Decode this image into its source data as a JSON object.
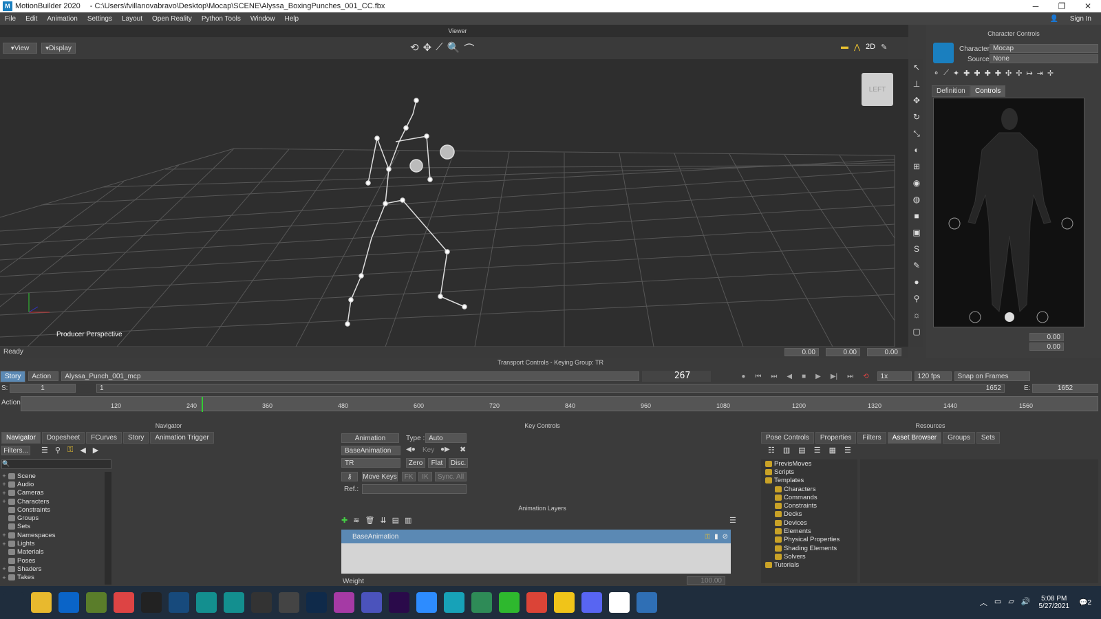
{
  "window": {
    "app_name": "MotionBuilder 2020",
    "file_path": "- C:\\Users\\fvillanovabravo\\Desktop\\Mocap\\SCENE\\Alyssa_BoxingPunches_001_CC.fbx",
    "sign_in": "Sign In"
  },
  "menu": [
    "File",
    "Edit",
    "Animation",
    "Settings",
    "Layout",
    "Open Reality",
    "Python Tools",
    "Window",
    "Help"
  ],
  "viewer": {
    "title": "Viewer",
    "view_btn": "View",
    "display_btn": "Display",
    "camera_label": "Producer Perspective",
    "cube_label": "LEFT",
    "status": "Ready",
    "coord_x": "0.00",
    "coord_y": "0.00",
    "coord_z": "0.00"
  },
  "character_controls": {
    "title": "Character Controls",
    "character_label": "Character:",
    "character_value": "Mocap",
    "source_label": "Source:",
    "source_value": "None",
    "tab_definition": "Definition",
    "tab_controls": "Controls",
    "value1": "0.00",
    "value2": "0.00"
  },
  "transport": {
    "title": "Transport Controls - Keying Group: TR",
    "story_tab": "Story",
    "action_tab": "Action",
    "take": "Alyssa_Punch_001_mcp",
    "frame_display": "267",
    "speed": "1x",
    "fps": "120 fps",
    "snap": "Snap on Frames",
    "start_label": "S:",
    "start_value": "1",
    "start_value2": "1",
    "end_label": "E:",
    "end_value": "1652",
    "end_value2": "1652",
    "action_label": "Action",
    "ticks": [
      "120",
      "240",
      "360",
      "480",
      "600",
      "720",
      "840",
      "960",
      "1080",
      "1200",
      "1320",
      "1440",
      "1560"
    ]
  },
  "navigator": {
    "title": "Navigator",
    "tabs": [
      "Navigator",
      "Dopesheet",
      "FCurves",
      "Story",
      "Animation Trigger"
    ],
    "filters": "Filters...",
    "items": [
      "Scene",
      "Audio",
      "Cameras",
      "Characters",
      "Constraints",
      "Groups",
      "Sets",
      "Namespaces",
      "Lights",
      "Materials",
      "Poses",
      "Shaders",
      "Takes"
    ]
  },
  "key_controls": {
    "title": "Key Controls",
    "animation_btn": "Animation",
    "type_label": "Type :",
    "type_value": "Auto",
    "layer_value": "BaseAnimation",
    "key_btn": "Key",
    "group_value": "TR",
    "zero_btn": "Zero",
    "flat_btn": "Flat",
    "disc_btn": "Disc.",
    "move_keys_btn": "Move Keys",
    "fk_btn": "FK",
    "ik_btn": "IK",
    "sync_btn": "Sync. All",
    "ref_label": "Ref.:",
    "layers_title": "Animation Layers",
    "layer_row": "BaseAnimation",
    "weight_label": "Weight",
    "weight_value": "100.00"
  },
  "resources": {
    "title": "Resources",
    "tabs": [
      "Pose Controls",
      "Properties",
      "Filters",
      "Asset Browser",
      "Groups",
      "Sets"
    ],
    "tree": [
      {
        "label": "PrevisMoves",
        "level": 0
      },
      {
        "label": "Scripts",
        "level": 0
      },
      {
        "label": "Templates",
        "level": 0
      },
      {
        "label": "Characters",
        "level": 1
      },
      {
        "label": "Commands",
        "level": 1
      },
      {
        "label": "Constraints",
        "level": 1
      },
      {
        "label": "Decks",
        "level": 1
      },
      {
        "label": "Devices",
        "level": 1
      },
      {
        "label": "Elements",
        "level": 1
      },
      {
        "label": "Physical Properties",
        "level": 1
      },
      {
        "label": "Shading Elements",
        "level": 1
      },
      {
        "label": "Solvers",
        "level": 1
      },
      {
        "label": "Tutorials",
        "level": 0
      }
    ]
  },
  "taskbar": {
    "time": "5:08 PM",
    "date": "5/27/2021",
    "notif": "2",
    "icons": [
      "start",
      "explorer",
      "mail",
      "minecraft",
      "app",
      "epic",
      "steam",
      "motionbuilder",
      "motionbuilder-active",
      "unity",
      "search-app",
      "photoshop",
      "app2",
      "teams",
      "premiere",
      "zoom",
      "app3",
      "globe",
      "app4",
      "chrome",
      "sticky",
      "discord",
      "w-app",
      "photos"
    ]
  },
  "colors": {
    "accent": "#1a7fbf",
    "layer_row": "#5b89b4",
    "viewport_bg": "#2e2e2e"
  }
}
